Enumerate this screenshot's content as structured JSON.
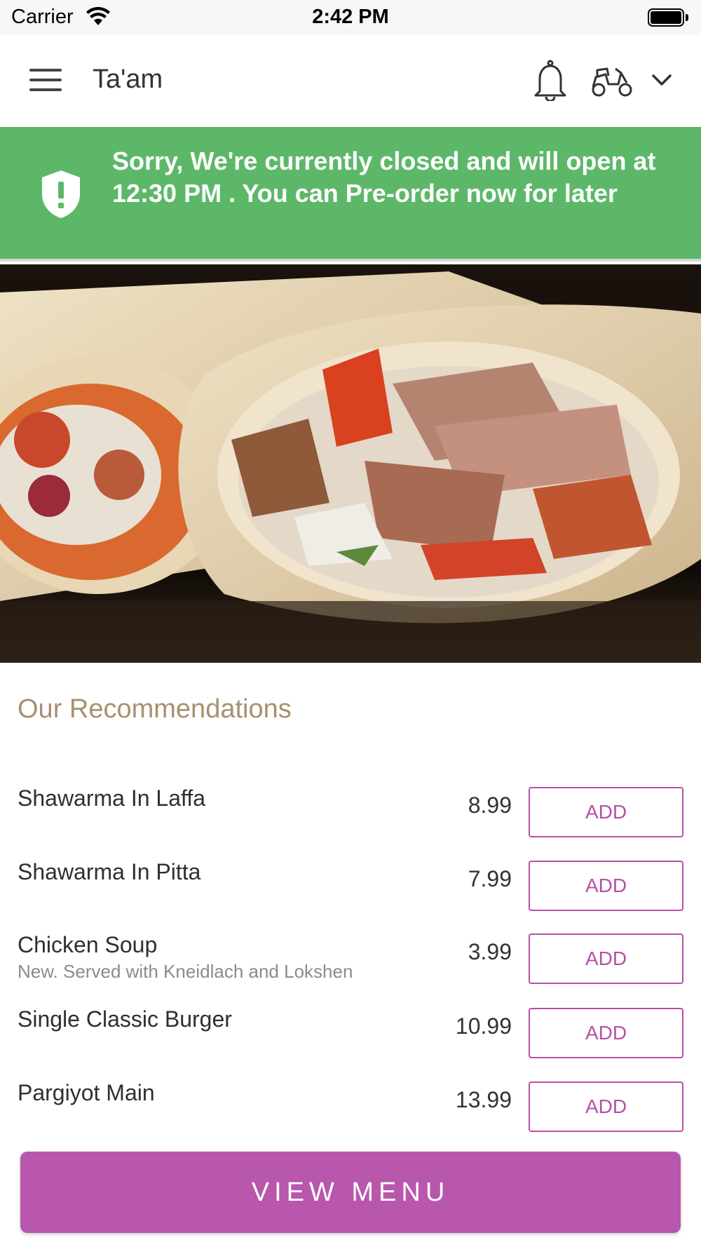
{
  "status_bar": {
    "carrier": "Carrier",
    "time": "2:42 PM"
  },
  "header": {
    "title": "Ta'am",
    "icons": [
      "menu-icon",
      "bell-icon",
      "scooter-icon",
      "chevron-down-icon"
    ]
  },
  "banner": {
    "message": "Sorry, We're currently closed and will open at 12:30 PM . You can Pre-order now for later",
    "color": "#5cb868",
    "icon": "shield-alert-icon"
  },
  "recommendations": {
    "title": "Our Recommendations",
    "items": [
      {
        "name": "Shawarma In Laffa",
        "description": "",
        "price": "8.99",
        "add_label": "ADD"
      },
      {
        "name": "Shawarma In Pitta",
        "description": "",
        "price": "7.99",
        "add_label": "ADD"
      },
      {
        "name": "Chicken Soup",
        "description": "New. Served with Kneidlach and Lokshen",
        "price": "3.99",
        "add_label": "ADD"
      },
      {
        "name": "Single Classic Burger",
        "description": "",
        "price": "10.99",
        "add_label": "ADD"
      },
      {
        "name": "Pargiyot Main",
        "description": "",
        "price": "13.99",
        "add_label": "ADD"
      }
    ]
  },
  "footer": {
    "view_menu_label": "VIEW MENU"
  },
  "colors": {
    "accent": "#b857ab",
    "section_title": "#a69170",
    "banner": "#5cb868"
  }
}
